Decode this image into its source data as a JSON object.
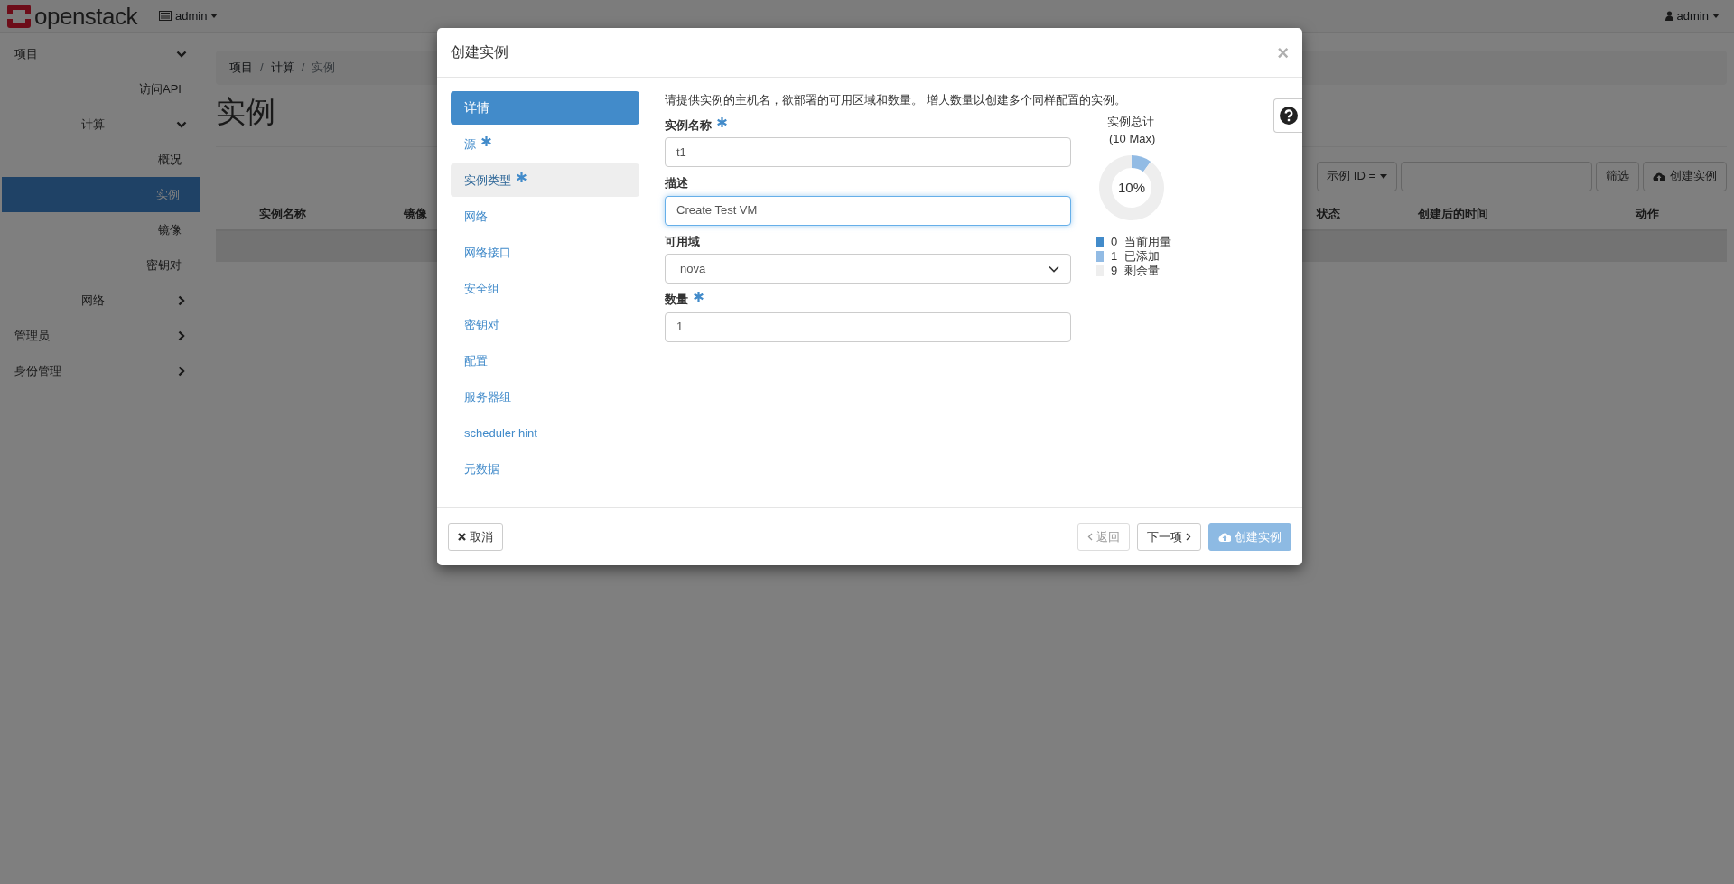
{
  "topbar": {
    "logo": "openstack",
    "project_menu": "admin",
    "user_menu": "admin"
  },
  "sidebar": {
    "items": [
      {
        "label": "项目",
        "expanded": true,
        "children": [
          {
            "label": "访问API",
            "selected": false
          },
          {
            "label": "计算",
            "expanded": true,
            "children": [
              {
                "label": "概况",
                "selected": false
              },
              {
                "label": "实例",
                "selected": true
              },
              {
                "label": "镜像",
                "selected": false
              },
              {
                "label": "密钥对",
                "selected": false
              }
            ]
          },
          {
            "label": "网络",
            "expanded": false
          }
        ]
      },
      {
        "label": "管理员",
        "expanded": false
      },
      {
        "label": "身份管理",
        "expanded": false
      }
    ]
  },
  "breadcrumb": [
    {
      "kind": "link",
      "text": "项目"
    },
    {
      "kind": "separator",
      "text": "/"
    },
    {
      "kind": "link",
      "text": "计算"
    },
    {
      "kind": "separator",
      "text": "/"
    },
    {
      "kind": "current",
      "text": "实例"
    }
  ],
  "page_title": "实例",
  "toolbar": {
    "filter_menu": "示例 ID =",
    "filter_button": "筛选",
    "create_button": "创建实例"
  },
  "table": {
    "columns": [
      "实例名称",
      "镜像",
      "状态",
      "创建后的时间",
      "动作"
    ]
  },
  "modal": {
    "title": "创建实例",
    "close": "×",
    "steps": [
      {
        "label": "详情",
        "selected": true,
        "required": false,
        "highlighted": false
      },
      {
        "label": "源",
        "selected": false,
        "required": true,
        "highlighted": false
      },
      {
        "label": "实例类型",
        "selected": false,
        "required": true,
        "highlighted": true
      },
      {
        "label": "网络",
        "selected": false,
        "required": false,
        "highlighted": false
      },
      {
        "label": "网络接口",
        "selected": false,
        "required": false,
        "highlighted": false
      },
      {
        "label": "安全组",
        "selected": false,
        "required": false,
        "highlighted": false
      },
      {
        "label": "密钥对",
        "selected": false,
        "required": false,
        "highlighted": false
      },
      {
        "label": "配置",
        "selected": false,
        "required": false,
        "highlighted": false
      },
      {
        "label": "服务器组",
        "selected": false,
        "required": false,
        "highlighted": false
      },
      {
        "label": "scheduler hint",
        "selected": false,
        "required": false,
        "highlighted": false
      },
      {
        "label": "元数据",
        "selected": false,
        "required": false,
        "highlighted": false
      }
    ],
    "intro": "请提供实例的主机名，欲部署的可用区域和数量。 增大数量以创建多个同样配置的实例。",
    "fields": [
      {
        "kind": "text",
        "label": "实例名称",
        "required": true,
        "value": "t1",
        "focused": false
      },
      {
        "kind": "text",
        "label": "描述",
        "required": false,
        "value": "Create Test VM",
        "focused": true
      },
      {
        "kind": "select",
        "label": "可用域",
        "required": false,
        "value": "nova",
        "focused": false
      },
      {
        "kind": "text",
        "label": "数量",
        "required": true,
        "value": "1",
        "focused": false
      }
    ],
    "quota": {
      "title": "实例总计",
      "subtitle": "(10 Max)",
      "center_label": "10%",
      "chart_data": {
        "type": "donut",
        "categories": [
          "当前用量",
          "已添加",
          "剩余量"
        ],
        "series": [
          {
            "values": [
              0,
              10,
              90
            ]
          }
        ]
      },
      "legend": [
        {
          "count": "0",
          "color": "#428bca"
        },
        {
          "count": "1",
          "color": "#92bbe4"
        },
        {
          "count": "9",
          "color": "#eeeeee"
        }
      ]
    },
    "footer": {
      "cancel": "取消",
      "back": {
        "label": "返回",
        "disabled": true
      },
      "next": {
        "label": "下一项",
        "disabled": false
      },
      "create": {
        "label": "创建实例",
        "disabled": true
      }
    }
  }
}
